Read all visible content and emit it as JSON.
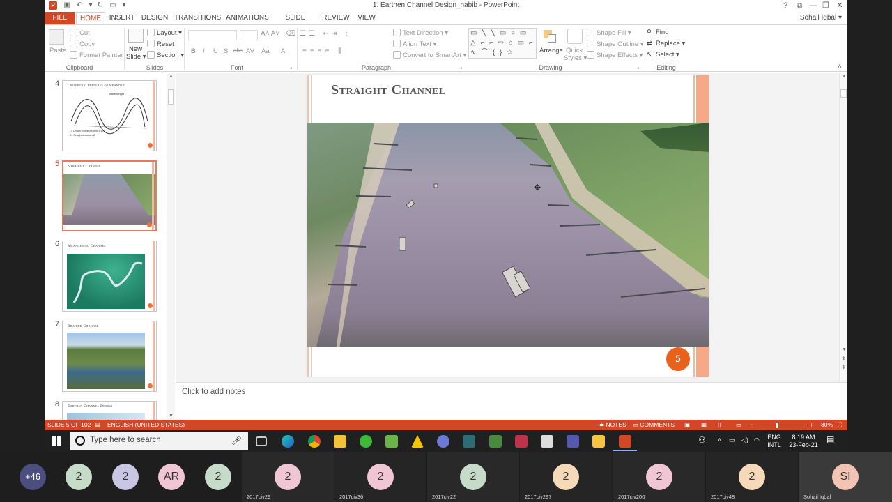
{
  "window": {
    "title": "1. Earthen Channel Design_habib - PowerPoint",
    "controls": [
      "?",
      "⧉",
      "—",
      "❐",
      "✕"
    ]
  },
  "tabs": [
    {
      "label": "FILE"
    },
    {
      "label": "HOME"
    },
    {
      "label": "INSERT"
    },
    {
      "label": "DESIGN"
    },
    {
      "label": "TRANSITIONS"
    },
    {
      "label": "ANIMATIONS"
    },
    {
      "label": "SLIDE SHOW"
    },
    {
      "label": "REVIEW"
    },
    {
      "label": "VIEW"
    }
  ],
  "user": "Sohail Iqbal",
  "ribbon": {
    "clipboard": {
      "paste": "Paste",
      "cut": "Cut",
      "copy": "Copy",
      "format_painter": "Format Painter",
      "label": "Clipboard"
    },
    "slides": {
      "new_slide": "New",
      "new_slide2": "Slide",
      "layout": "Layout",
      "reset": "Reset",
      "section": "Section",
      "label": "Slides"
    },
    "font": {
      "label": "Font",
      "buttons": [
        "B",
        "I",
        "U",
        "S",
        "abc",
        "AV",
        "Aa",
        "A"
      ]
    },
    "paragraph": {
      "text_direction": "Text Direction",
      "align_text": "Align Text",
      "convert": "Convert to SmartArt",
      "label": "Paragraph"
    },
    "drawing": {
      "shapes": "▭ ╲ ╲ ▭ ○ ▭ △ ⌐ ⌐ ⇨ ⌂ ▭ ⌐ ∿ ⌒ { } ☆",
      "arrange": "Arrange",
      "quick_styles": "Quick",
      "quick_styles2": "Styles",
      "shape_fill": "Shape Fill",
      "shape_outline": "Shape Outline",
      "shape_effects": "Shape Effects",
      "label": "Drawing"
    },
    "editing": {
      "find": "Find",
      "replace": "Replace",
      "select": "Select",
      "label": "Editing"
    }
  },
  "thumbnails": [
    {
      "num": "4",
      "title": "Geometric features of meander"
    },
    {
      "num": "5",
      "title": "Straight Channel"
    },
    {
      "num": "6",
      "title": "Meandering Channel"
    },
    {
      "num": "7",
      "title": "Braided Channel"
    },
    {
      "num": "8",
      "title": "Earthen Channel Design"
    }
  ],
  "thumb4": {
    "label1": "Wave length",
    "label2": "L= Length of channel from A to B",
    "label3": "S= Straight distance AB"
  },
  "slide": {
    "title": "Straight Channel",
    "number": "5"
  },
  "notes_placeholder": "Click to add notes",
  "status": {
    "slide": "SLIDE 5 OF 102",
    "language": "ENGLISH (UNITED STATES)",
    "notes": "NOTES",
    "comments": "COMMENTS",
    "zoom": "80%",
    "zoom_level": 0.8
  },
  "taskbar": {
    "search_placeholder": "Type here to search",
    "lang1": "ENG",
    "lang2": "INTL",
    "time": "8:19 AM",
    "date": "23-Feb-21"
  },
  "meeting": {
    "tiles": [
      {
        "avatar": "+46",
        "name": ""
      },
      {
        "avatar": "2",
        "name": ""
      },
      {
        "avatar": "2",
        "name": ""
      },
      {
        "avatar": "AR",
        "name": ""
      },
      {
        "avatar": "2",
        "name": ""
      },
      {
        "avatar": "2",
        "name": "2017civ29"
      },
      {
        "avatar": "2",
        "name": "2017civ36"
      },
      {
        "avatar": "2",
        "name": "2017civ22"
      },
      {
        "avatar": "2",
        "name": "2017civ297"
      },
      {
        "avatar": "2",
        "name": "2017civ200"
      },
      {
        "avatar": "2",
        "name": "2017civ48"
      },
      {
        "avatar": "SI",
        "name": "Sohail Iqbal"
      }
    ],
    "colors": {
      "purple": "#4b4e7e",
      "green": "#c6dcc9",
      "lavender": "#c8c6e2",
      "pink": "#f0c6d5",
      "peach": "#f5d9b8",
      "salmon": "#f3c3b3"
    }
  },
  "colors": {
    "accent": "#d24726",
    "slide_num": "#e8621c"
  }
}
